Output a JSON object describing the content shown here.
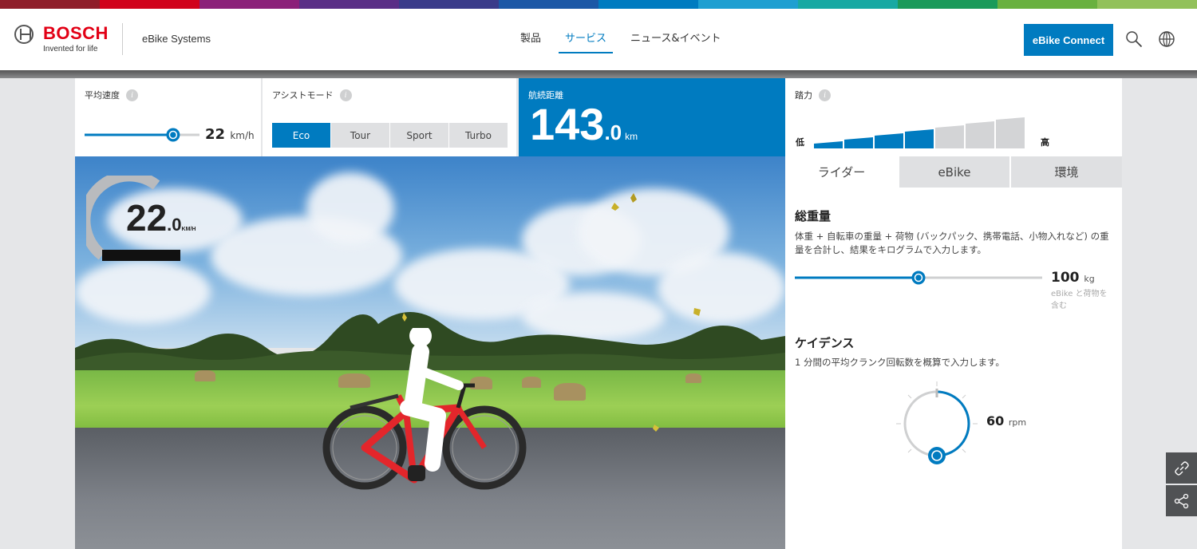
{
  "rainbow": [
    "#8f1e2a",
    "#d0021b",
    "#8b2079",
    "#5a2e86",
    "#3a3b8a",
    "#1c58a6",
    "#007bc0",
    "#1e9fd1",
    "#17a9a3",
    "#1a9a5a",
    "#69b13f",
    "#92c15a"
  ],
  "colors": {
    "accent": "#007bc0",
    "brand_red": "#e20015"
  },
  "header": {
    "brand": "BOSCH",
    "tagline": "Invented for life",
    "product": "eBike Systems",
    "nav": [
      {
        "label": "製品",
        "active": false
      },
      {
        "label": "サービス",
        "active": true
      },
      {
        "label": "ニュース&イベント",
        "active": false
      }
    ],
    "connect_button": "eBike Connect",
    "icons": [
      "search-icon",
      "globe-icon"
    ]
  },
  "avg_speed": {
    "label": "平均速度",
    "value": "22",
    "unit": "km/h",
    "level": 0.77
  },
  "assist": {
    "label": "アシストモード",
    "modes": [
      "Eco",
      "Tour",
      "Sport",
      "Turbo"
    ],
    "selected": "Eco"
  },
  "range": {
    "label": "航続距離",
    "integer": "143",
    "decimal": ".0",
    "unit": "km"
  },
  "pedal": {
    "label": "踏力",
    "low": "低",
    "high": "高",
    "level": 4,
    "steps": 7
  },
  "gauge": {
    "integer": "22",
    "decimal": ".0",
    "unit": "KM/H"
  },
  "panel": {
    "tabs": [
      "ライダー",
      "eBike",
      "環境"
    ],
    "active_tab": "ライダー",
    "weight": {
      "title": "総重量",
      "desc": "体重 + 自転車の重量 + 荷物 (バックパック、携帯電話、小物入れなど) の重量を合計し、結果をキログラムで入力します。",
      "value": "100",
      "unit": "kg",
      "note": "eBike と荷物を含む",
      "level": 0.5
    },
    "cadence": {
      "title": "ケイデンス",
      "desc": "1 分間の平均クランク回転数を概算で入力します。",
      "value": "60",
      "unit": "rpm"
    }
  },
  "side_buttons": [
    "link-icon",
    "share-icon"
  ]
}
